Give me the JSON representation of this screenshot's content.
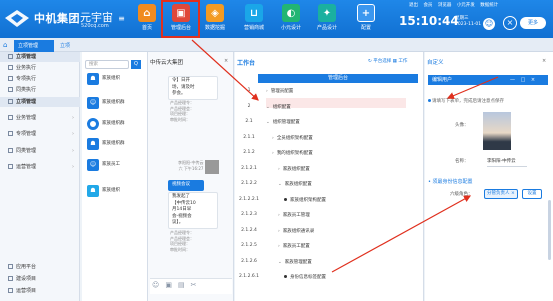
{
  "app": {
    "brand": "中机集团",
    "brand_sub": "元宇宙",
    "brand_url": "520cq.com"
  },
  "colors": {
    "primary": "#1a7be0",
    "annotation": "#e0301e",
    "highlight_bg": "#fbe7e7"
  },
  "top_nav": [
    {
      "label": "首页",
      "icon": "home-icon",
      "color": "#f08b1f"
    },
    {
      "label": "管理后台",
      "icon": "admin-console-icon",
      "color": "#e0483a"
    },
    {
      "label": "数据挖掘",
      "icon": "data-mining-icon",
      "color": "#f39b23"
    },
    {
      "label": "营销商城",
      "icon": "shopping-cart-icon",
      "color": "#1aa6e8"
    },
    {
      "label": "小元设计",
      "icon": "design-icon",
      "color": "#22b573"
    },
    {
      "label": "产品设计",
      "icon": "product-icon",
      "color": "#1ab0a0"
    },
    {
      "label": "配置",
      "icon": "plus-icon",
      "color": "#1f87e8"
    }
  ],
  "top_links": [
    "退出",
    "会员",
    "浏览器",
    "小元开发",
    "数据统计"
  ],
  "clock": "15:10:44",
  "date_line1": "星期三",
  "date_line2": "2023-11-01",
  "more_label": "更多",
  "tab": {
    "active": "立项管理",
    "more": "立项"
  },
  "sidebar": {
    "section1": "立项管理",
    "items1": [
      "业务执行",
      "专项执行",
      "同类执行"
    ],
    "section2": "立项管理",
    "items2": [
      "业务管理",
      "专项管理",
      "同类管理",
      "运营管理"
    ],
    "bottom": [
      "应用平台",
      "建设项目",
      "运营项目"
    ]
  },
  "contacts": {
    "search_placeholder": "搜索",
    "search_btn": "Q",
    "list": [
      "家族组织",
      "家族组织群",
      "家族组织群",
      "家族组织群",
      "家族员工",
      "家族组织"
    ]
  },
  "chat": {
    "title": "中传云大集团",
    "close": "×",
    "msg1": "令】日开\n场，请及时\n参会。",
    "sub1": "产品经理令：\n产品经理会：\n项目经理：\n审批时间：",
    "meta": "李阳阳-中传云\n六 下午16:27",
    "msg2_head": "视频会议",
    "msg2": "我发起了\n【中传云10\n月14日早\n会-视频会\n议】。",
    "sub2": "产品经理令：\n产品经理会：\n项目经理：\n审批时间："
  },
  "workbench": {
    "title": "工作台",
    "actions": [
      "平台选择",
      "工作"
    ],
    "column_header": "管理后台",
    "rows": [
      {
        "num": "1",
        "text": "管理员配置",
        "marker": "›"
      },
      {
        "num": "2",
        "text": "组织配置",
        "marker": "⌄",
        "highlight": true
      },
      {
        "num": "2.1",
        "text": "组织管理配置",
        "marker": "⌄"
      },
      {
        "num": "2.1.1",
        "text": "全员组织架构配置",
        "marker": "›"
      },
      {
        "num": "2.1.2",
        "text": "我的组织架构配置",
        "marker": "›"
      },
      {
        "num": "2.1.2.1",
        "text": "家族组织配置",
        "marker": "›"
      },
      {
        "num": "2.1.2.2",
        "text": "家族组织配置",
        "marker": "⌄"
      },
      {
        "num": "2.1.2.2.1",
        "text": "家族组织架构配置",
        "marker": "•"
      },
      {
        "num": "2.1.2.3",
        "text": "家族员工管理",
        "marker": "›"
      },
      {
        "num": "2.1.2.4",
        "text": "家族组织通讯录",
        "marker": "›"
      },
      {
        "num": "2.1.2.5",
        "text": "家族员工配置",
        "marker": "›"
      },
      {
        "num": "2.1.2.6",
        "text": "家族管理配置",
        "marker": "⌄"
      },
      {
        "num": "2.1.2.6.1",
        "text": "身份信息标签配置",
        "marker": "•"
      }
    ]
  },
  "right_panel": {
    "title": "自定义",
    "close": "×",
    "dialog_title": "编辑用户",
    "dialog_ctrls": "— □ ×",
    "note": "请填写下表单，完成后请注意点保存",
    "photo_label": "头像：",
    "name_label": "名称：",
    "name_value": "李阳阳-中传云",
    "section_title": "• 须最身份信息配置",
    "role_label": "六级角色：",
    "role_value": "分管负责人",
    "role_tag": "×",
    "role_btn": "设置"
  }
}
